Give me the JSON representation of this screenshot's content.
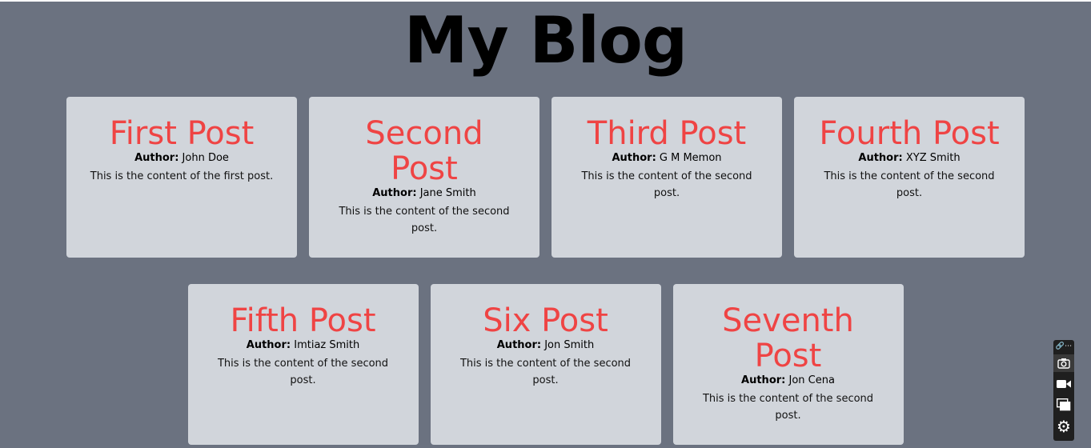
{
  "header": {
    "title": "My Blog"
  },
  "labels": {
    "author_prefix": "Author:"
  },
  "posts_row1": [
    {
      "title": "First Post",
      "author": "John Doe",
      "content": "This is the content of the first post."
    },
    {
      "title": "Second Post",
      "author": "Jane Smith",
      "content": "This is the content of the second post."
    },
    {
      "title": "Third Post",
      "author": "G M Memon",
      "content": "This is the content of the second post."
    },
    {
      "title": "Fourth Post",
      "author": "XYZ Smith",
      "content": "This is the content of the second post."
    }
  ],
  "posts_row2": [
    {
      "title": "Fifth Post",
      "author": "Imtiaz Smith",
      "content": "This is the content of the second post."
    },
    {
      "title": "Six Post",
      "author": "Jon Smith",
      "content": "This is the content of the second post."
    },
    {
      "title": "Seventh Post",
      "author": "Jon Cena",
      "content": "This is the content of the second post."
    }
  ],
  "colors": {
    "background": "#6b7280",
    "card": "#d1d5db",
    "post_title": "#ef4444"
  },
  "toolbar": {
    "icons": [
      "link-icon",
      "more-icon",
      "camera-icon",
      "video-icon",
      "window-icon",
      "gear-icon"
    ]
  }
}
